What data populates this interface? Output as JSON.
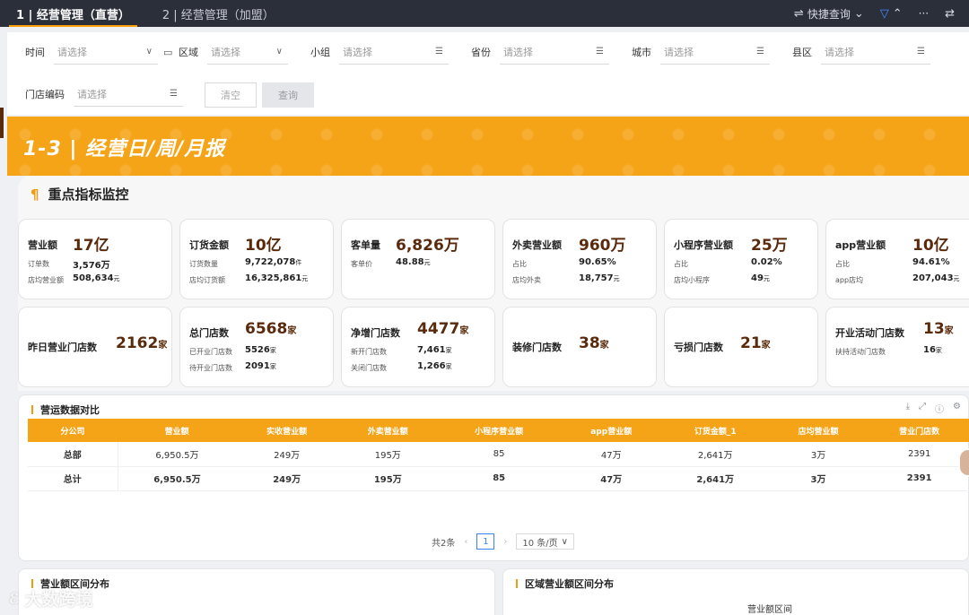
{
  "tabs": [
    {
      "label": "1 | 经营管理（直营）",
      "active": true
    },
    {
      "label": "2 | 经营管理（加盟）",
      "active": false
    }
  ],
  "topbar": {
    "quick_query": "快捷查询",
    "more": "···"
  },
  "filters": {
    "time": {
      "label": "时间",
      "placeholder": "请选择"
    },
    "region": {
      "label": "区域",
      "placeholder": "请选择"
    },
    "group": {
      "label": "小组",
      "placeholder": "请选择"
    },
    "province": {
      "label": "省份",
      "placeholder": "请选择"
    },
    "city": {
      "label": "城市",
      "placeholder": "请选择"
    },
    "county": {
      "label": "县区",
      "placeholder": "请选择"
    },
    "store_code": {
      "label": "门店编码",
      "placeholder": "请选择"
    },
    "clear_label": "清空",
    "query_label": "查询"
  },
  "banner": {
    "title": "1-3 | 经营日/周/月报"
  },
  "kpi_section": {
    "title": "重点指标监控"
  },
  "cards_row1": [
    {
      "title": "营业额",
      "big": "17亿",
      "sub1": "订单数",
      "val1": "3,576万",
      "unit1": "",
      "sub2": "店均营业额",
      "val2": "508,634",
      "unit2": "元"
    },
    {
      "title": "订货金额",
      "big": "10亿",
      "sub1": "订货数量",
      "val1": "9,722,078",
      "unit1": "件",
      "sub2": "店均订货额",
      "val2": "16,325,861",
      "unit2": "元"
    },
    {
      "title": "客单量",
      "big": "6,826万",
      "sub1": "客单价",
      "val1": "48.88",
      "unit1": "元",
      "sub2": "",
      "val2": "",
      "unit2": ""
    },
    {
      "title": "外卖营业额",
      "big": "960万",
      "sub1": "占比",
      "val1": "90.65%",
      "unit1": "",
      "sub2": "店均外卖",
      "val2": "18,757",
      "unit2": "元"
    },
    {
      "title": "小程序营业额",
      "big": "25万",
      "sub1": "占比",
      "val1": "0.02%",
      "unit1": "",
      "sub2": "店均小程序",
      "val2": "49",
      "unit2": "元"
    },
    {
      "title": "app营业额",
      "big": "10亿",
      "sub1": "占比",
      "val1": "94.61%",
      "unit1": "",
      "sub2": "app店均",
      "val2": "207,043",
      "unit2": "元"
    }
  ],
  "cards_row2": [
    {
      "title": "昨日营业门店数",
      "big": "2162",
      "unit": "家",
      "sub1": "",
      "val1": "",
      "unit1": "",
      "sub2": "",
      "val2": "",
      "unit2": ""
    },
    {
      "title": "总门店数",
      "big": "6568",
      "unit": "家",
      "sub1": "已开业门店数",
      "val1": "5526",
      "unit1": "家",
      "sub2": "待开业门店数",
      "val2": "2091",
      "unit2": "家"
    },
    {
      "title": "净增门店数",
      "big": "4477",
      "unit": "家",
      "sub1": "新开门店数",
      "val1": "7,461",
      "unit1": "家",
      "sub2": "关闭门店数",
      "val2": "1,266",
      "unit2": "家"
    },
    {
      "title": "装修门店数",
      "big": "38",
      "unit": "家",
      "sub1": "",
      "val1": "",
      "unit1": "",
      "sub2": "",
      "val2": "",
      "unit2": ""
    },
    {
      "title": "亏损门店数",
      "big": "21",
      "unit": "家",
      "sub1": "",
      "val1": "",
      "unit1": "",
      "sub2": "",
      "val2": "",
      "unit2": ""
    },
    {
      "title": "开业活动门店数",
      "big": "13",
      "unit": "家",
      "sub1": "扶持活动门店数",
      "val1": "16",
      "unit1": "家",
      "sub2": "",
      "val2": "",
      "unit2": ""
    }
  ],
  "compare_panel": {
    "title": "营运数据对比",
    "headers": [
      "分公司",
      "营业额",
      "实收营业额",
      "外卖营业额",
      "小程序营业额",
      "app营业额",
      "订货金额_1",
      "店均营业额",
      "营业门店数"
    ],
    "rows": [
      [
        "总部",
        "6,950.5万",
        "249万",
        "195万",
        "85",
        "47万",
        "2,641万",
        "3万",
        "2391"
      ],
      [
        "总计",
        "6,950.5万",
        "249万",
        "195万",
        "85",
        "47万",
        "2,641万",
        "3万",
        "2391"
      ]
    ],
    "pager": {
      "total": "共2条",
      "page": "1",
      "size": "10 条/页"
    }
  },
  "panel_left": {
    "title": "营业额区间分布"
  },
  "panel_right": {
    "title": "区域营业额区间分布",
    "subtitle": "营业额区间"
  },
  "watermark": "大数跨境",
  "colors": {
    "accent": "#f5a317",
    "brand_dark": "#5a2a0c",
    "topbar": "#2b2f3a",
    "link": "#3b82f6"
  }
}
